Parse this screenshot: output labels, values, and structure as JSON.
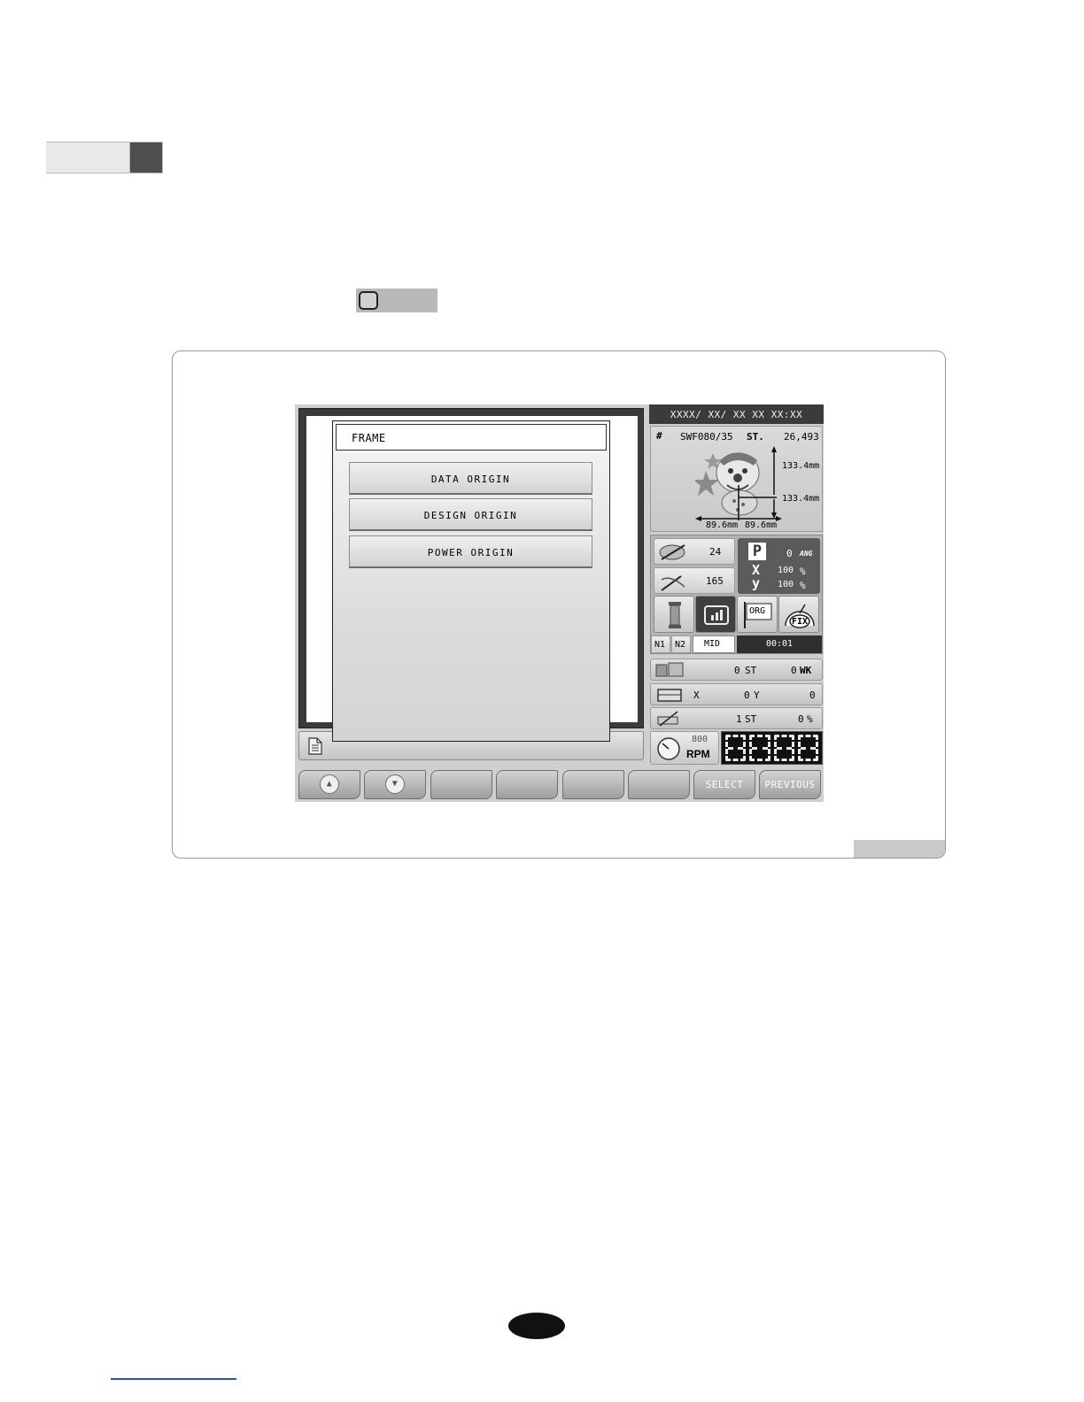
{
  "dialog": {
    "title": "FRAME",
    "items": [
      "DATA  ORIGIN",
      "DESIGN  ORIGIN",
      "POWER  ORIGIN"
    ]
  },
  "header": {
    "datetime": "XXXX/ XX/ XX  XX XX:XX"
  },
  "design": {
    "hash": "#",
    "name": "SWF080/35",
    "st_label": "ST.",
    "stitches": "26,493",
    "height_top": "133.4mm",
    "height_bottom": "133.4mm",
    "width_left": "89.6mm",
    "width_right": "89.6mm"
  },
  "counters": {
    "needle_value": "24",
    "thread_value": "165"
  },
  "params": {
    "p_label": "P",
    "angle": "0",
    "ang_label": "ANG",
    "x_label": "X",
    "x_scale": "100",
    "x_unit": "%",
    "y_label": "y",
    "y_scale": "100",
    "y_unit": "%"
  },
  "icons": {
    "org_label": "ORG",
    "fix_label": "FIX"
  },
  "modes": {
    "n1": "N1",
    "n2": "N2",
    "speed_mode": "MID",
    "timer": "00:01"
  },
  "production": {
    "st_value": "0",
    "st_label": "ST",
    "wk_value": "0",
    "wk_label": "WK"
  },
  "position": {
    "x_label": "X",
    "x_value": "0",
    "y_label": "Y",
    "y_value": "0"
  },
  "progress": {
    "st_value": "1",
    "st_label": "ST",
    "percent": "0",
    "percent_label": "%"
  },
  "speed": {
    "rpm_value": "800",
    "rpm_label": "RPM"
  },
  "softkeys": {
    "up": "▲",
    "down": "▼",
    "select": "SELECT",
    "previous": "PREVIOUS"
  }
}
